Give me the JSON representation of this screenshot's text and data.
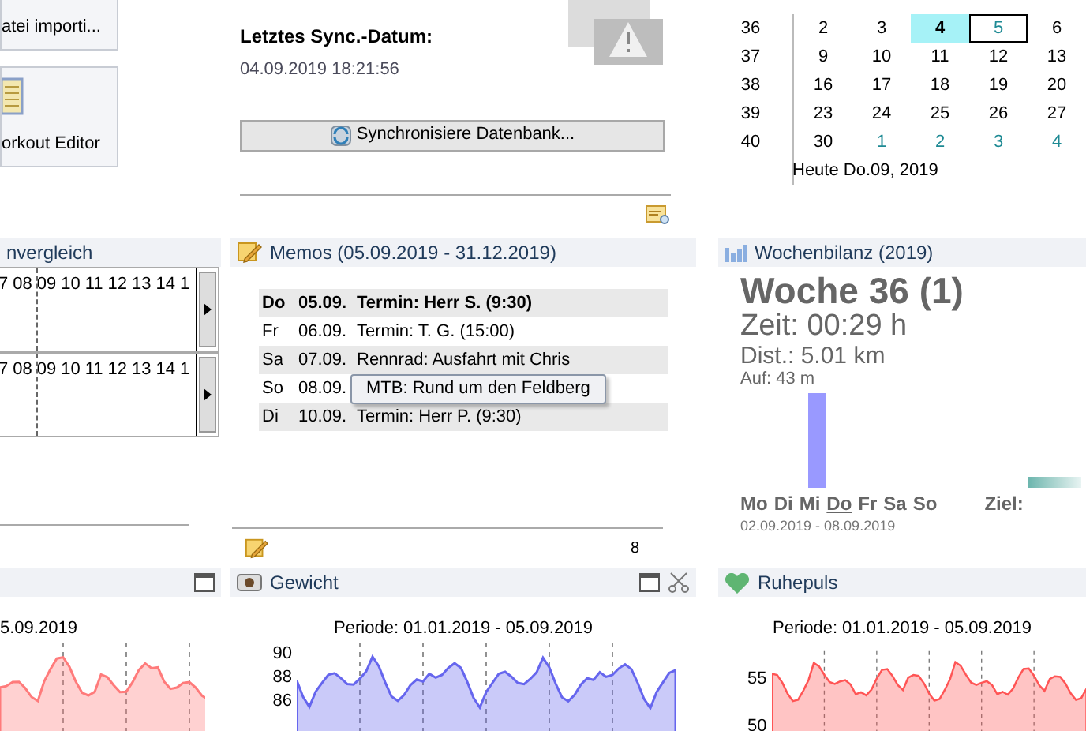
{
  "tiles": [
    {
      "label": "atei importi..."
    },
    {
      "label": "orkout Editor"
    }
  ],
  "sync": {
    "heading": "Letztes Sync.-Datum:",
    "date": "04.09.2019 18:21:56",
    "button": "Synchronisiere Datenbank..."
  },
  "calendar": {
    "weeks": [
      {
        "number": "36",
        "days": [
          {
            "day": "2",
            "other_month": false,
            "today": false,
            "selected": false
          },
          {
            "day": "3",
            "other_month": false,
            "today": false,
            "selected": false
          },
          {
            "day": "4",
            "other_month": false,
            "today": true,
            "selected": false
          },
          {
            "day": "5",
            "other_month": false,
            "today": false,
            "selected": true
          },
          {
            "day": "6",
            "other_month": false,
            "today": false,
            "selected": false
          }
        ]
      },
      {
        "number": "37",
        "days": [
          {
            "day": "9",
            "other_month": false,
            "today": false,
            "selected": false
          },
          {
            "day": "10",
            "other_month": false,
            "today": false,
            "selected": false
          },
          {
            "day": "11",
            "other_month": false,
            "today": false,
            "selected": false
          },
          {
            "day": "12",
            "other_month": false,
            "today": false,
            "selected": false
          },
          {
            "day": "13",
            "other_month": false,
            "today": false,
            "selected": false
          }
        ]
      },
      {
        "number": "38",
        "days": [
          {
            "day": "16",
            "other_month": false,
            "today": false,
            "selected": false
          },
          {
            "day": "17",
            "other_month": false,
            "today": false,
            "selected": false
          },
          {
            "day": "18",
            "other_month": false,
            "today": false,
            "selected": false
          },
          {
            "day": "19",
            "other_month": false,
            "today": false,
            "selected": false
          },
          {
            "day": "20",
            "other_month": false,
            "today": false,
            "selected": false
          }
        ]
      },
      {
        "number": "39",
        "days": [
          {
            "day": "23",
            "other_month": false,
            "today": false,
            "selected": false
          },
          {
            "day": "24",
            "other_month": false,
            "today": false,
            "selected": false
          },
          {
            "day": "25",
            "other_month": false,
            "today": false,
            "selected": false
          },
          {
            "day": "26",
            "other_month": false,
            "today": false,
            "selected": false
          },
          {
            "day": "27",
            "other_month": false,
            "today": false,
            "selected": false
          }
        ]
      },
      {
        "number": "40",
        "days": [
          {
            "day": "30",
            "other_month": false,
            "today": false,
            "selected": false
          },
          {
            "day": "1",
            "other_month": true,
            "today": false,
            "selected": false
          },
          {
            "day": "2",
            "other_month": true,
            "today": false,
            "selected": false
          },
          {
            "day": "3",
            "other_month": true,
            "today": false,
            "selected": false
          },
          {
            "day": "4",
            "other_month": true,
            "today": false,
            "selected": false
          }
        ]
      }
    ],
    "footer": "Heute Do.09, 2019"
  },
  "timeline": {
    "title": "nvergleich",
    "rows": [
      {
        "hours": [
          "7",
          "08",
          "09",
          "10",
          "11",
          "12",
          "13",
          "14",
          "1"
        ]
      },
      {
        "hours": [
          "7",
          "08",
          "09",
          "10",
          "11",
          "12",
          "13",
          "14",
          "1"
        ]
      }
    ]
  },
  "memos": {
    "title": "Memos (05.09.2019 - 31.12.2019)",
    "items": [
      {
        "day": "Do",
        "date": "05.09.",
        "text": "Termin: Herr S. (9:30)",
        "today": true
      },
      {
        "day": "Fr",
        "date": "06.09.",
        "text": "Termin: T. G. (15:00)",
        "today": false
      },
      {
        "day": "Sa",
        "date": "07.09.",
        "text": "Rennrad: Ausfahrt mit Chris",
        "today": false
      },
      {
        "day": "So",
        "date": "08.09.",
        "today": false
      },
      {
        "day": "Di",
        "date": "10.09.",
        "text": "Termin: Herr P. (9:30)",
        "today": false
      }
    ],
    "tooltip": "MTB: Rund um den Feldberg",
    "count": "8"
  },
  "week": {
    "title": "Wochenbilanz (2019)",
    "week": "Woche 36 (1)",
    "time": "Zeit: 00:29 h",
    "distance": "Dist.: 5.01 km",
    "ascent": "Auf: 43 m",
    "days": [
      {
        "label": "Mo",
        "today": false
      },
      {
        "label": "Di",
        "today": false
      },
      {
        "label": "Mi",
        "today": false
      },
      {
        "label": "Do",
        "today": true
      },
      {
        "label": "Fr",
        "today": false
      },
      {
        "label": "Sa",
        "today": false
      },
      {
        "label": "So",
        "today": false
      }
    ],
    "goal": "Ziel:",
    "range": "02.09.2019 - 08.09.2019"
  },
  "bottom": {
    "left": {
      "chart_title": "5.09.2019"
    },
    "weight": {
      "title": "Gewicht",
      "chart_title": "Periode: 01.01.2019 - 05.09.2019",
      "y_ticks": [
        "90",
        "88",
        "86"
      ]
    },
    "pulse": {
      "title": "Ruhepuls",
      "chart_title": "Periode: 01.01.2019 - 05.09.2019",
      "y_ticks": [
        "55",
        "50"
      ]
    }
  }
}
